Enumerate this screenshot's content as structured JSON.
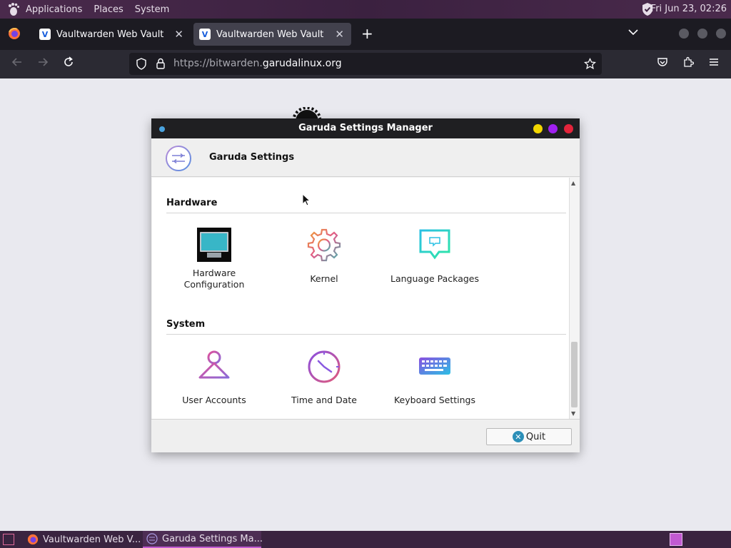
{
  "top_panel": {
    "menus": [
      "Applications",
      "Places",
      "System"
    ],
    "clock": "Fri Jun 23, 02:26"
  },
  "browser": {
    "tabs": [
      {
        "title": "Vaultwarden Web Vault",
        "active": false
      },
      {
        "title": "Vaultwarden Web Vault",
        "active": true
      }
    ],
    "url_prefix": "https://bitwarden.",
    "url_host": "garudalinux.org",
    "url_suffix": ""
  },
  "dialog": {
    "window_title": "Garuda Settings Manager",
    "header_title": "Garuda Settings",
    "sections": [
      {
        "title": "Hardware",
        "items": [
          {
            "label": "Hardware\nConfiguration",
            "icon": "monitor-icon"
          },
          {
            "label": "Kernel",
            "icon": "gear-icon"
          },
          {
            "label": "Language Packages",
            "icon": "speech-bubble-icon"
          }
        ]
      },
      {
        "title": "System",
        "items": [
          {
            "label": "User Accounts",
            "icon": "hanger-icon"
          },
          {
            "label": "Time and Date",
            "icon": "clock-icon"
          },
          {
            "label": "Keyboard Settings",
            "icon": "keyboard-icon"
          }
        ]
      }
    ],
    "quit_label": "Quit"
  },
  "taskbar": {
    "tasks": [
      {
        "title": "Vaultwarden Web V..."
      },
      {
        "title": "Garuda Settings Ma..."
      }
    ]
  },
  "colors": {
    "dot_yellow": "#f2d600",
    "dot_purple": "#a020f0",
    "dot_red": "#e3243b",
    "accent_blue": "#4aa3df"
  }
}
